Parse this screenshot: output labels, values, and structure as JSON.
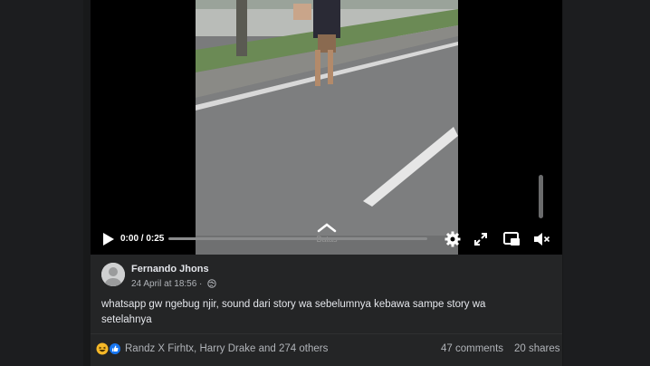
{
  "video": {
    "time": "0:00 / 0:25",
    "progress": 0.0,
    "chevron_label": "Batas",
    "icons": [
      "play-icon",
      "settings-icon",
      "fullscreen-icon",
      "picture-in-picture-icon",
      "muted-icon"
    ]
  },
  "post": {
    "author": "Fernando Jhons",
    "timestamp": "24 April at 18:56 ·",
    "privacy_icon": "globe-icon",
    "text": "whatsapp gw ngebug njir, sound dari story wa sebelumnya kebawa sampe story wa setelahnya"
  },
  "reactions": {
    "icons": [
      "haha-icon",
      "like-icon"
    ],
    "names": "Randz X Firhtx, Harry Drake and 274 others",
    "comments": "47 comments",
    "shares": "20 shares"
  },
  "colors": {
    "background": "#18191a",
    "card": "#242526",
    "text": "#e4e6eb",
    "secondary_text": "#b0b3b8",
    "like_blue": "#1877f2",
    "haha_yellow": "#f7b928"
  }
}
